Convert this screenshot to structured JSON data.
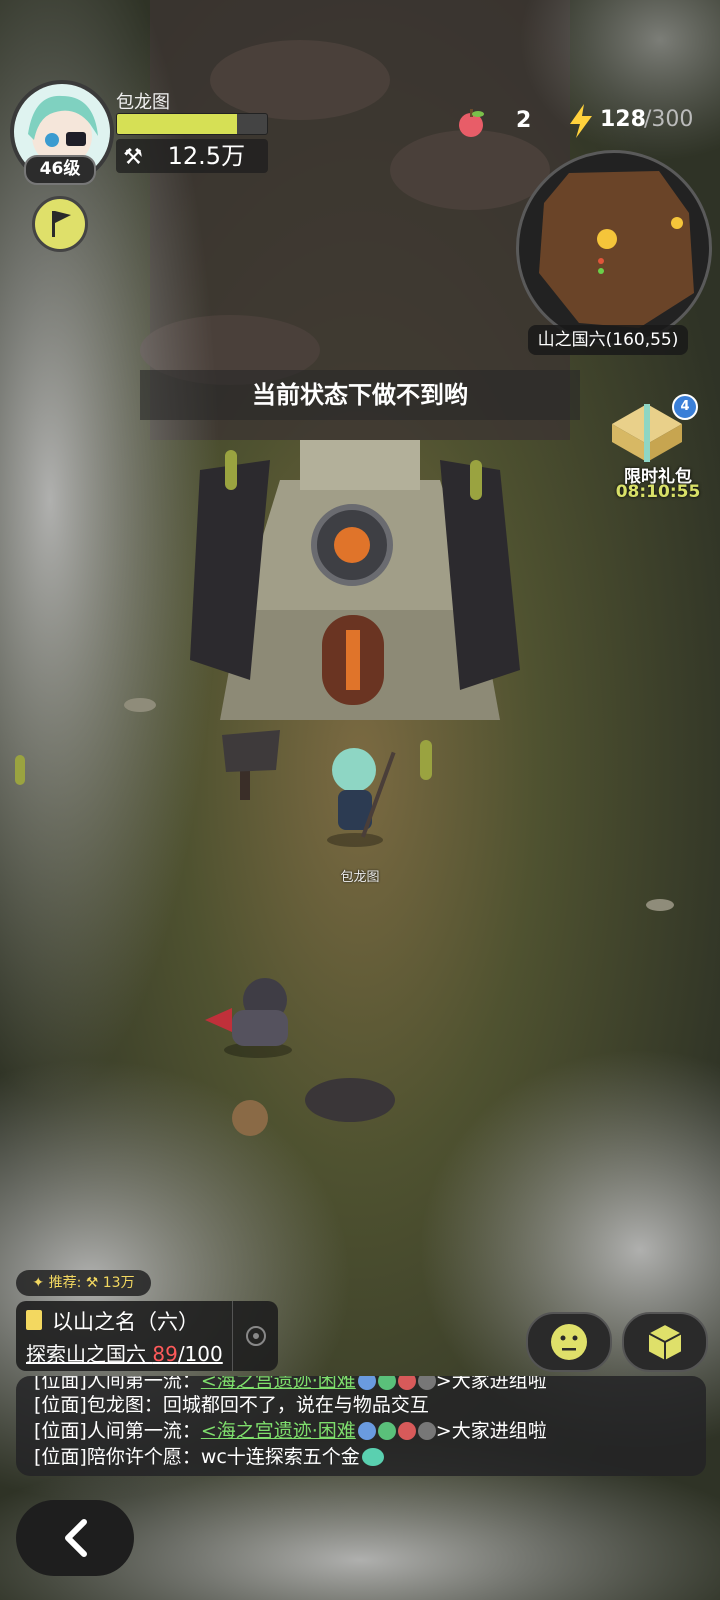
{
  "player": {
    "name": "包龙图",
    "level": "46级",
    "hp_fraction": 0.8,
    "power_icon": "crossed-tools-icon",
    "power": "12.5万"
  },
  "resources": {
    "apple_icon": "apple-icon",
    "apples": "2",
    "energy_icon": "lightning-icon",
    "energy_current": "128",
    "energy_max": "/300"
  },
  "minimap": {
    "location": "山之国六(160,55)"
  },
  "toast": "当前状态下做不到哟",
  "gift": {
    "label": "限时礼包",
    "timer": "08:10:55",
    "badge": "4"
  },
  "character_label": "包龙图",
  "quest": {
    "recommend": "推荐:",
    "recommend_power": "13万",
    "title": "以山之名（六）",
    "progress_label": "探索山之国六 ",
    "progress_current": "89",
    "progress_total": "/100"
  },
  "chat": [
    {
      "prefix": "[位面]人间第一流：",
      "link": "<海之宫遗迹·困难",
      "suffix": ">大家进组啦"
    },
    {
      "prefix": "[位面]包龙图：回城都回不了，说在与物品交互",
      "link": "",
      "suffix": ""
    },
    {
      "prefix": "[位面]人间第一流：",
      "link": "<海之宫遗迹·困难",
      "suffix": ">大家进组啦"
    },
    {
      "prefix": "[位面]陪你许个愿：wc十连探索五个金",
      "link": "",
      "suffix": ""
    }
  ],
  "colors": {
    "accent_yellow": "#d6e055",
    "link_green": "#7ede6c",
    "progress_red": "#ff5a5a"
  }
}
